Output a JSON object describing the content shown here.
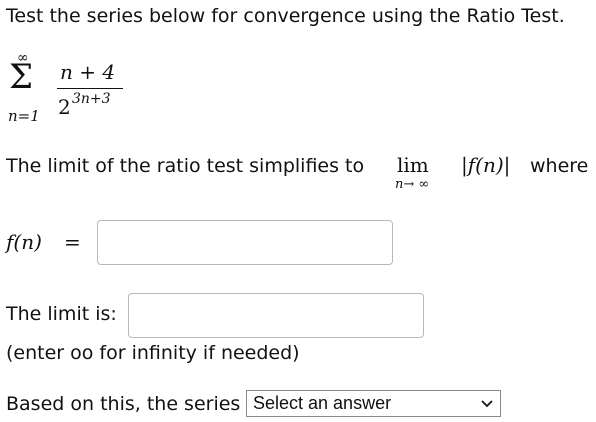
{
  "question": {
    "prompt": "Test the series below for convergence using the Ratio Test.",
    "series": {
      "sigma": "Σ",
      "upper_limit": "∞",
      "lower_limit": "n=1",
      "numerator": "n + 4",
      "denominator_base": "2",
      "denominator_exponent": "3n+3"
    },
    "limit_statement_prefix": "The limit of the ratio test simplifies to",
    "lim_word": "lim",
    "lim_subscript": "n→ ∞",
    "abs_expression": "|f(n)|",
    "limit_statement_suffix": "where",
    "f_label": "f(n)",
    "equals": "=",
    "f_input": {
      "value": "",
      "placeholder": ""
    },
    "limit_label": "The limit is:",
    "limit_input": {
      "value": "",
      "placeholder": ""
    },
    "infinity_hint": "(enter oo for infinity if needed)",
    "conclusion_prefix": "Based on this, the series",
    "conclusion_select": {
      "selected": "Select an answer"
    }
  },
  "colors": {
    "text": "#111111",
    "input_border": "#b8b8b8",
    "select_border": "#8a8a8a"
  }
}
